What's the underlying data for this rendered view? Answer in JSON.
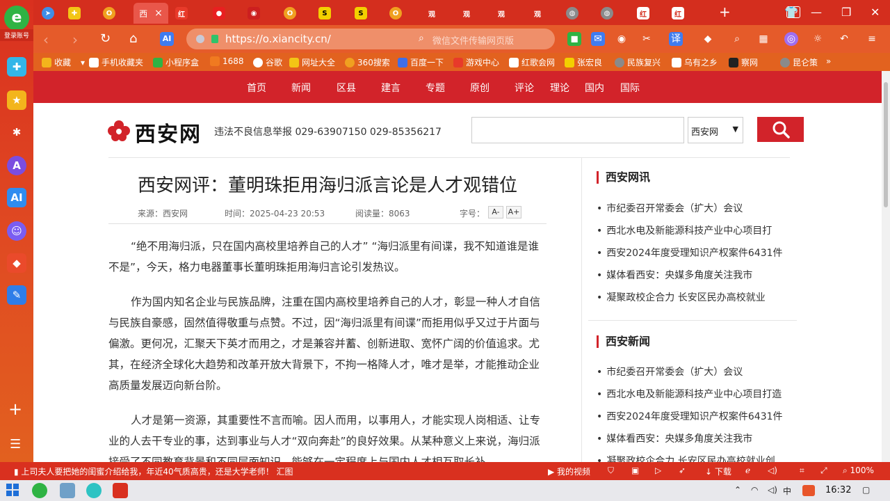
{
  "sidebar": {
    "logo_glyph": "e",
    "login_label": "登录账号"
  },
  "tabs": {
    "active_title": "西",
    "close_glyph": "×",
    "count": "19"
  },
  "toolbar": {
    "url": "https://o.xiancity.cn/",
    "search_placeholder": "微信文件传输网页版",
    "ai_label": "AI",
    "translate_label": "译"
  },
  "bookmarks": [
    "收藏",
    "手机收藏夹",
    "小程序盒",
    "1688",
    "谷歌",
    "网址大全",
    "360搜索",
    "百度一下",
    "游戏中心",
    "红歌会网",
    "张宏良",
    "民族复兴",
    "乌有之乡",
    "察网",
    "昆仑策"
  ],
  "site_nav": [
    "首页",
    "新闻",
    "区县",
    "建言",
    "专题",
    "原创",
    "评论",
    "理论",
    "国内",
    "国际"
  ],
  "header": {
    "logo_text": "西安网",
    "report": "违法不良信息举报 029-63907150 029-85356217",
    "select_value": "西安网"
  },
  "article": {
    "title": "西安网评：董明珠拒用海归派言论是人才观错位",
    "source": "来源：西安网",
    "time": "时间：2025-04-23 20:53",
    "reads": "阅读量：8063",
    "font_label": "字号：",
    "font_minus": "A-",
    "font_plus": "A+",
    "paragraphs": [
      "“绝不用海归派，只在国内高校里培养自己的人才” “海归派里有间谍，我不知道谁是谁不是”，今天，格力电器董事长董明珠拒用海归言论引发热议。",
      "作为国内知名企业与民族品牌，注重在国内高校里培养自己的人才，彰显一种人才自信与民族自豪感，固然值得敬重与点赞。不过，因“海归派里有间谍”而拒用似乎又过于片面与偏激。更何况，汇聚天下英才而用之，才是兼容并蓄、创新进取、宽怀广阔的价值追求。尤其，在经济全球化大趋势和改革开放大背景下，不拘一格降人才，唯才是举，才能推动企业高质量发展迈向新台阶。",
      "人才是第一资源，其重要性不言而喻。因人而用，以事用人，才能实现人岗相适、让专业的人去干专业的事，达到事业与人才“双向奔赴”的良好效果。从某种意义上来说，海归派接受了不同教育背景和不同层面知识，能够在一定程度上与国内人才相互取长补"
    ]
  },
  "side": {
    "section1_title": "西安网讯",
    "section1_items": [
      "市纪委召开常委会（扩大）会议",
      "西北水电及新能源科技产业中心项目打",
      "西安2024年度受理知识产权案件6431件",
      "媒体看西安：央媒多角度关注我市",
      "凝聚政校企合力 长安区民办高校就业"
    ],
    "section2_title": "西安新闻",
    "section2_items": [
      "市纪委召开常委会（扩大）会议",
      "西北水电及新能源科技产业中心项目打造",
      "西安2024年度受理知识产权案件6431件",
      "媒体看西安：央媒多角度关注我市",
      "凝聚政校企合力 长安区民办高校就业创"
    ]
  },
  "statusbar": {
    "news": "上司夫人要把她的闺蜜介绍给我，年近40气质高贵，还是大学老师！",
    "news_tag": "汇图",
    "video": "我的视频",
    "download": "下载",
    "zoom": "100%"
  },
  "taskbar": {
    "time": "16:32",
    "ime": "中"
  },
  "colors": {
    "brand_red": "#d2232a",
    "browser_red": "#d42e1e",
    "browser_orange": "#e55b2a"
  }
}
